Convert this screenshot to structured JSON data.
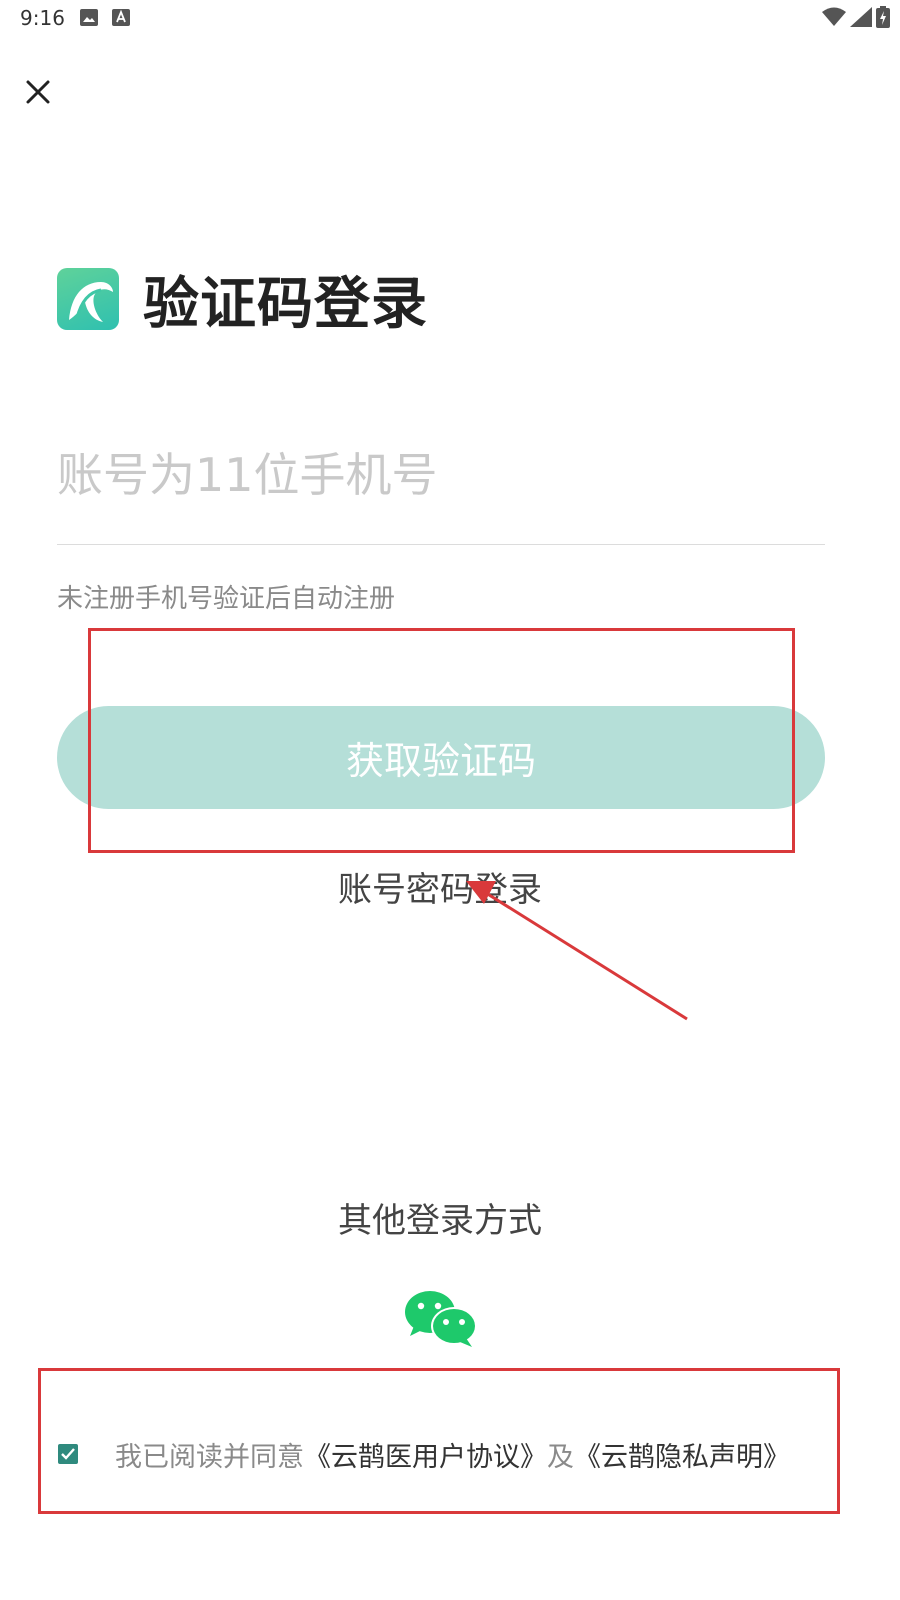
{
  "status_bar": {
    "time": "9:16",
    "icons": [
      "image-notification-icon",
      "text-notification-icon",
      "wifi-icon",
      "signal-icon",
      "battery-icon"
    ]
  },
  "header": {
    "close_icon": "close-icon"
  },
  "brand": {
    "title": "验证码登录",
    "logo_colors": [
      "#5fd29a",
      "#2fc0b0"
    ]
  },
  "form": {
    "phone_placeholder": "账号为11位手机号",
    "phone_value": "",
    "hint": "未注册手机号验证后自动注册",
    "get_code_label": "获取验证码",
    "get_code_color": "#b5dfd8",
    "password_login_label": "账号密码登录"
  },
  "other_login": {
    "label": "其他登录方式",
    "wechat_icon": "wechat-icon",
    "wechat_color": "#1ec96b"
  },
  "agreement": {
    "checked": true,
    "prefix": "我已阅读并同意",
    "user_agreement": "《云鹊医用户协议》",
    "connector": "及",
    "privacy_policy": "《云鹊隐私声明》"
  },
  "annotations": {
    "color": "#d9393b"
  }
}
